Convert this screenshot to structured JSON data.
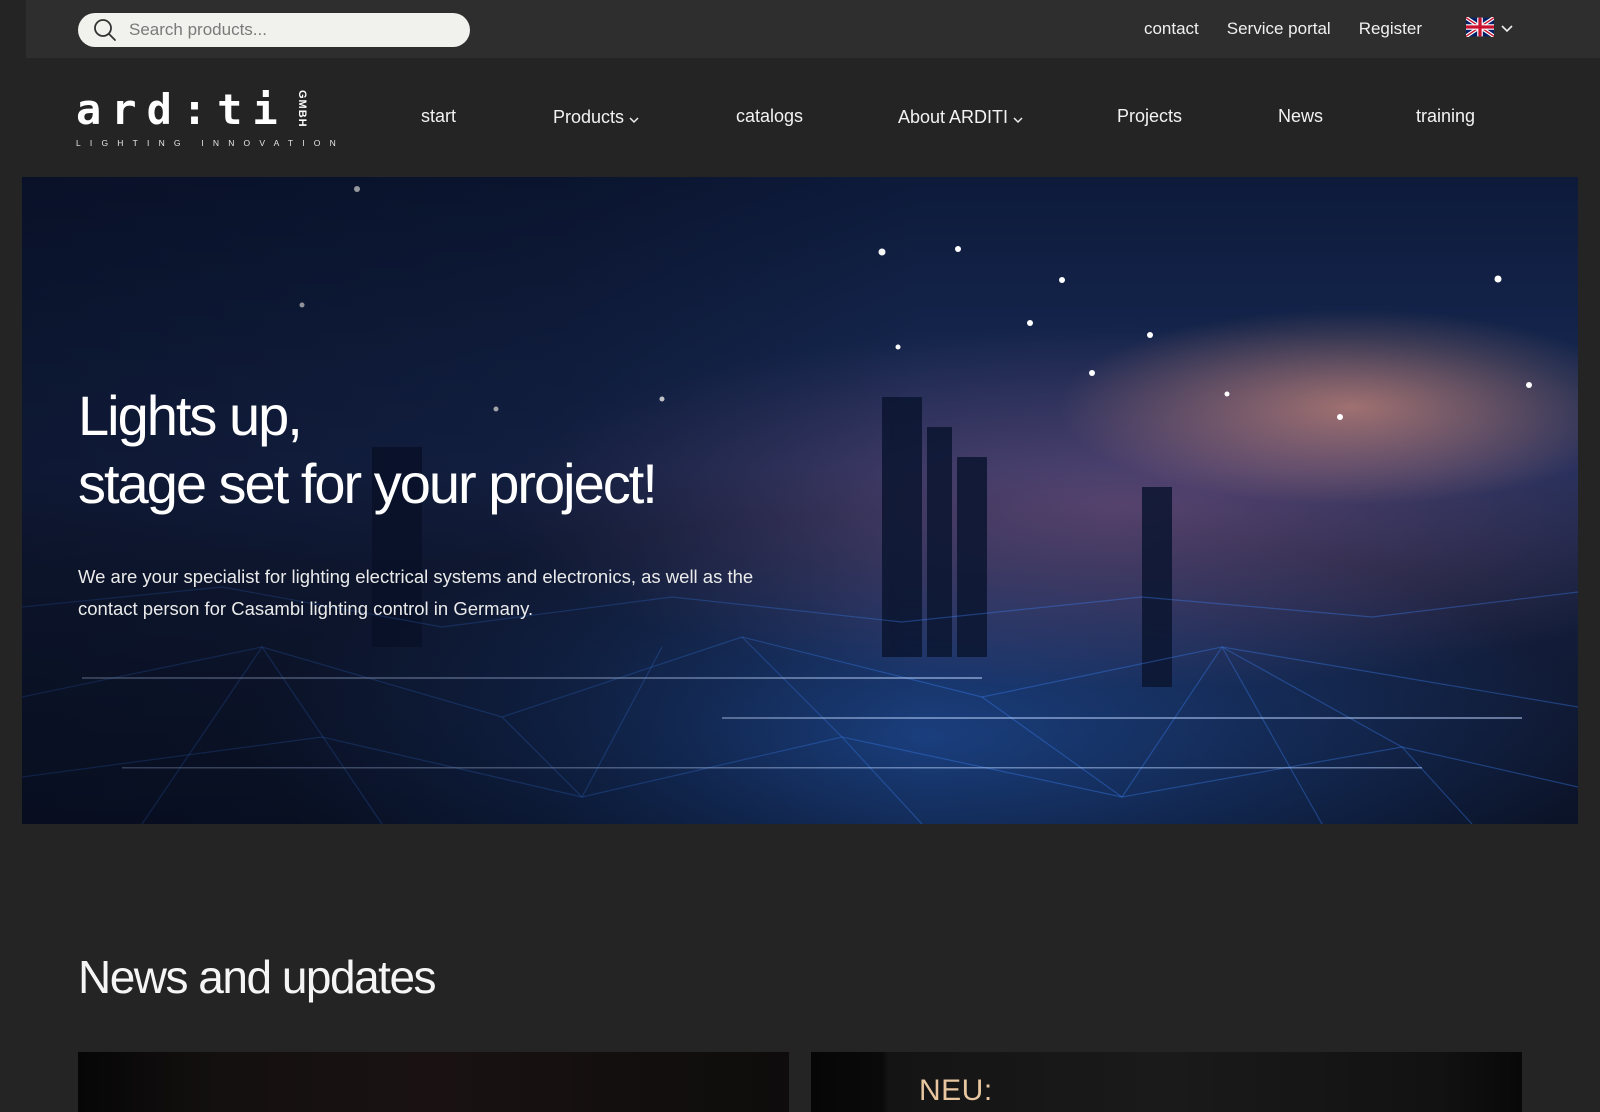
{
  "header": {
    "search": {
      "placeholder": "Search products..."
    },
    "links": [
      {
        "label": "contact"
      },
      {
        "label": "Service portal"
      },
      {
        "label": "Register"
      }
    ],
    "language": {
      "flag": "uk-flag-icon"
    }
  },
  "logo": {
    "word": "ard:ti",
    "suffix": "GMBH",
    "tagline": "LIGHTING INNOVATION"
  },
  "nav": {
    "items": [
      {
        "label": "start",
        "dropdown": false
      },
      {
        "label": "Products",
        "dropdown": true
      },
      {
        "label": "catalogs",
        "dropdown": false
      },
      {
        "label": "About ARDITI",
        "dropdown": true
      },
      {
        "label": "Projects",
        "dropdown": false
      },
      {
        "label": "News",
        "dropdown": false
      },
      {
        "label": "training",
        "dropdown": false
      }
    ]
  },
  "hero": {
    "title_line1": "Lights up,",
    "title_line2": "stage set for your project!",
    "text": "We are your specialist for lighting electrical systems and electronics, as well as the contact person for Casambi lighting control in Germany."
  },
  "news": {
    "title": "News and updates",
    "cards": [
      {
        "label": ""
      },
      {
        "label": "NEU:"
      }
    ]
  },
  "colors": {
    "page_bg": "#242424",
    "topbar_bg": "#2e2e2e",
    "search_bg": "#f1f1ee",
    "text": "#f2f2f2",
    "accent_peach": "#e8c6a0"
  }
}
